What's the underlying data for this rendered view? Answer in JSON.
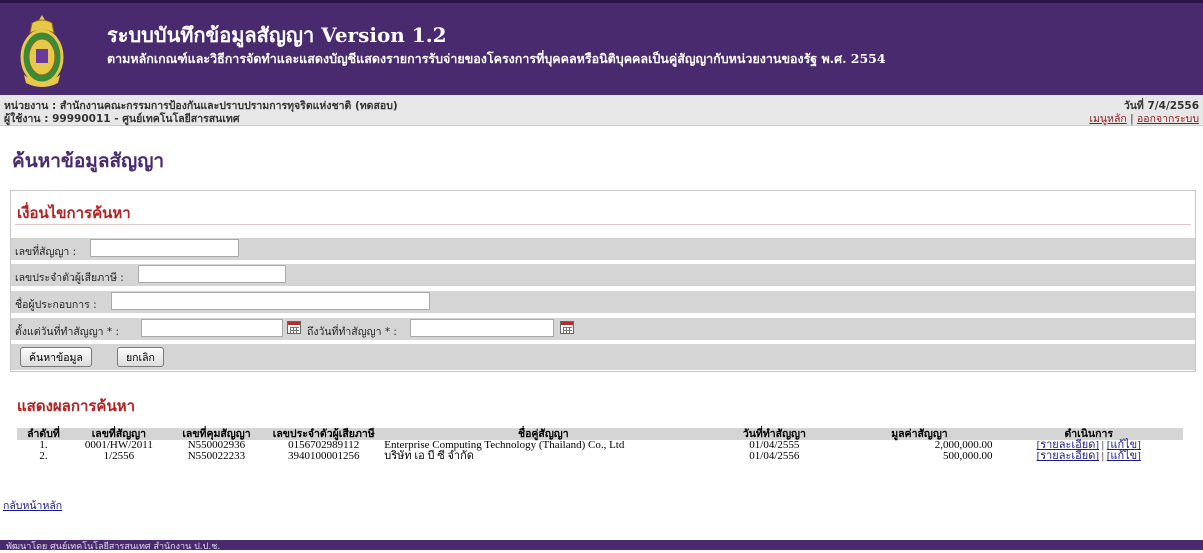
{
  "header": {
    "title": "ระบบบันทึกข้อมูลสัญญา Version 1.2",
    "subtitle": "ตามหลักเกณฑ์และวิธีการจัดทำและแสดงบัญชีแสดงรายการรับจ่ายของโครงการที่บุคคลหรือนิติบุคคลเป็นคู่สัญญากับหน่วยงานของรัฐ พ.ศ. 2554"
  },
  "infobar": {
    "agency": "หน่วยงาน : สำนักงานคณะกรรมการป้องกันและปราบปรามการทุจริตแห่งชาติ (ทดสอบ)",
    "user": "ผู้ใช้งาน : 99990011 - ศูนย์เทคโนโลยีสารสนเทศ",
    "date": "วันที่ 7/4/2556",
    "main_menu": "เมนูหลัก",
    "separator": "|",
    "logout": "ออกจากระบบ"
  },
  "page_title": "ค้นหาข้อมูลสัญญา",
  "search": {
    "heading": "เงื่อนไขการค้นหา",
    "contract_no_label": "เลขที่สัญญา :",
    "contract_no_value": "",
    "tax_id_label": "เลขประจำตัวผู้เสียภาษี :",
    "tax_id_value": "",
    "vendor_label": "ชื่อผู้ประกอบการ :",
    "vendor_value": "",
    "from_date_label": "ตั้งแต่วันที่ทำสัญญา * :",
    "from_date_value": "",
    "to_date_label": "ถึงวันที่ทำสัญญา * :",
    "to_date_value": "",
    "search_button": "ค้นหาข้อมูล",
    "cancel_button": "ยกเลิก"
  },
  "results": {
    "heading": "แสดงผลการค้นหา",
    "columns": [
      "ลำดับที่",
      "เลขที่สัญญา",
      "เลขที่คุมสัญญา",
      "เลขประจำตัวผู้เสียภาษี",
      "ชื่อคู่สัญญา",
      "วันที่ทำสัญญา",
      "มูลค่าสัญญา",
      "ดำเนินการ"
    ],
    "rows": [
      {
        "no": "1.",
        "contract_no": "0001/HW/2011",
        "control_no": "N550002936",
        "tax_id": "0156702989112",
        "party": "Enterprise Computing Technology (Thailand) Co., Ltd",
        "date": "01/04/2555",
        "value": "2,000,000.00",
        "detail": "[รายละเอียด]",
        "sep": "|",
        "edit": "[แก้ไข]"
      },
      {
        "no": "2.",
        "contract_no": "1/2556",
        "control_no": "N550022233",
        "tax_id": "3940100001256",
        "party": "บริษัท เอ บี ซี จำกัด",
        "date": "01/04/2556",
        "value": "500,000.00",
        "detail": "[รายละเอียด]",
        "sep": "|",
        "edit": "[แก้ไข]"
      }
    ]
  },
  "back_link": "กลับหน้าหลัก",
  "footer": "พัฒนาโดย ศูนย์เทคโนโลยีสารสนเทศ สำนักงาน ป.ป.ช.",
  "colors": {
    "banner": "#4a2a6e",
    "heading_red": "#b22222",
    "row_gray": "#d5d5d5"
  },
  "icons": {
    "logo": "seal-emblem",
    "calendar": "calendar-icon"
  }
}
